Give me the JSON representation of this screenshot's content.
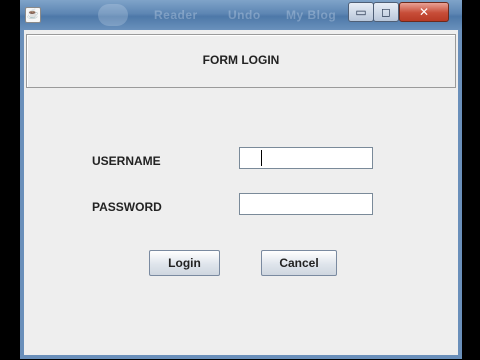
{
  "window": {
    "title_blur": [
      "Reader",
      "Undo",
      "My Blog"
    ],
    "controls": {
      "minimize": "▭",
      "maximize": "◻",
      "close": "✕"
    }
  },
  "header": {
    "title": "FORM LOGIN"
  },
  "form": {
    "username_label": "USERNAME",
    "password_label": "PASSWORD",
    "username_value": "",
    "password_value": ""
  },
  "buttons": {
    "login": "Login",
    "cancel": "Cancel"
  },
  "colors": {
    "window_bg": "#eeeeee",
    "titlebar": "#5d86b3",
    "close_button": "#c74d38"
  }
}
